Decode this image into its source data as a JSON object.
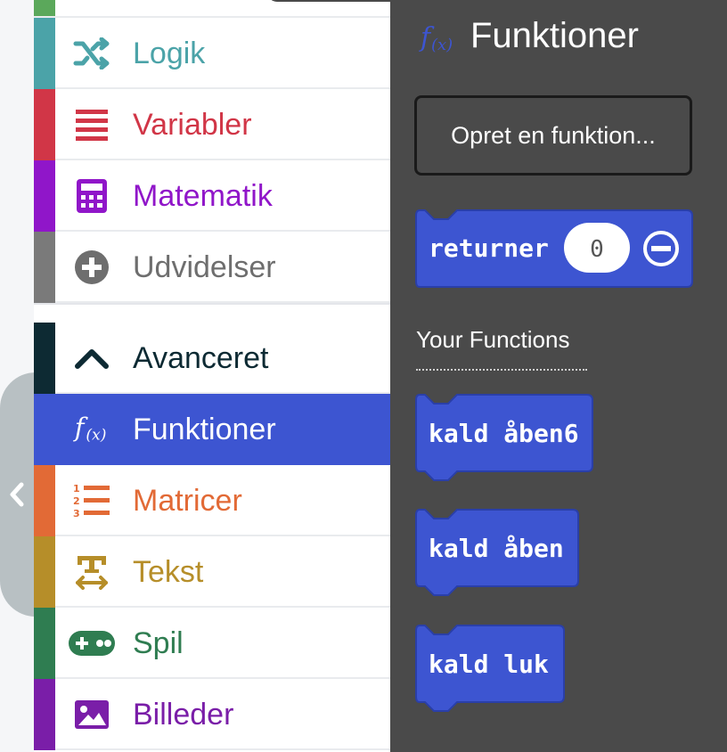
{
  "toolbox": {
    "categories": [
      {
        "label": "Logik",
        "color": "#4ba3a8",
        "icon": "shuffle-icon"
      },
      {
        "label": "Variabler",
        "color": "#d13647",
        "icon": "list-lines-icon"
      },
      {
        "label": "Matematik",
        "color": "#9016c9",
        "icon": "calculator-icon"
      },
      {
        "label": "Udvidelser",
        "color": "#6e6e6e",
        "icon": "plus-circle-icon"
      },
      {
        "label": "Avanceret",
        "color": "#0d2a33",
        "icon": "chevron-up-icon"
      },
      {
        "label": "Funktioner",
        "color": "#3d55d1",
        "icon": "function-icon"
      },
      {
        "label": "Matricer",
        "color": "#e26a36",
        "icon": "numbered-list-icon"
      },
      {
        "label": "Tekst",
        "color": "#b68e29",
        "icon": "text-format-icon"
      },
      {
        "label": "Spil",
        "color": "#2f7d51",
        "icon": "gamepad-icon"
      },
      {
        "label": "Billeder",
        "color": "#7a1ea8",
        "icon": "image-icon"
      }
    ],
    "selected": "Funktioner"
  },
  "flyout": {
    "title": "Funktioner",
    "make_function_button": "Opret en funktion...",
    "return_block": {
      "label": "returner",
      "value": "0"
    },
    "section_title": "Your Functions",
    "call_blocks": [
      "kald åben6",
      "kald åben",
      "kald luk"
    ],
    "block_color": "#3d55d1"
  }
}
